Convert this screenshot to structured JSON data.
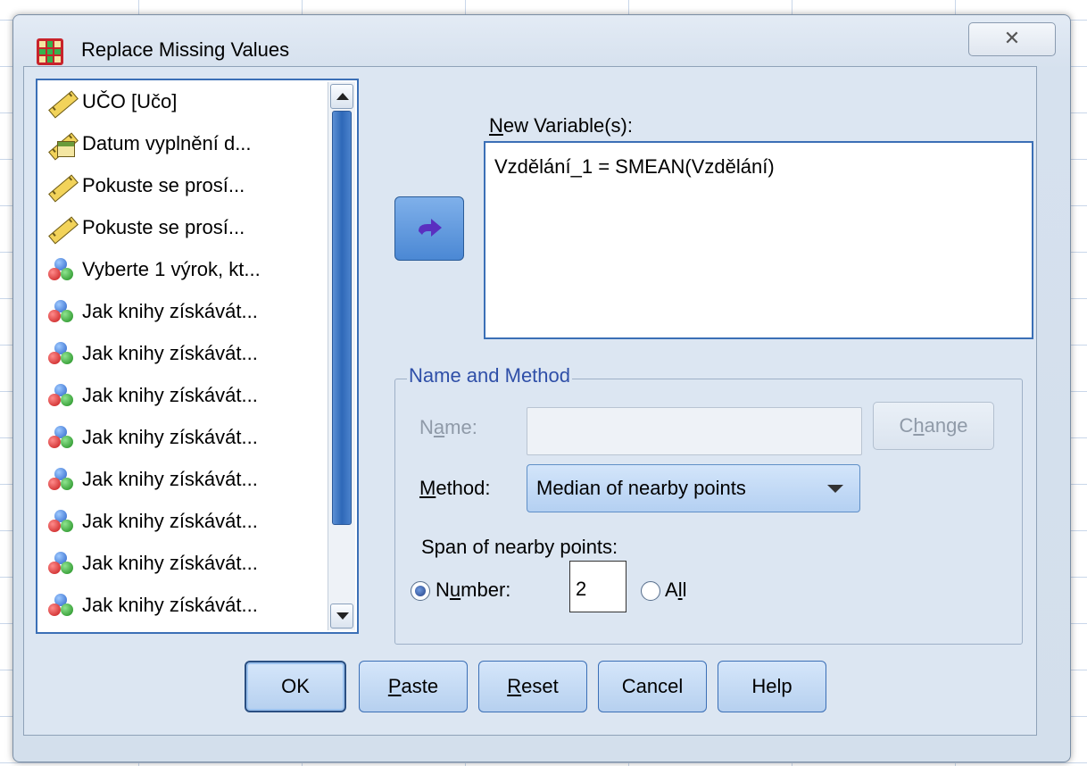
{
  "window": {
    "title": "Replace Missing Values",
    "close_glyph": "✕"
  },
  "variables": {
    "items": [
      {
        "label": "UČO [Učo]",
        "icon": "scale-ruler-icon"
      },
      {
        "label": "Datum vyplnění d...",
        "icon": "date-scale-icon"
      },
      {
        "label": "Pokuste se prosí...",
        "icon": "scale-ruler-icon"
      },
      {
        "label": "Pokuste se prosí...",
        "icon": "scale-ruler-icon"
      },
      {
        "label": "Vyberte 1 výrok, kt...",
        "icon": "nominal-balls-icon"
      },
      {
        "label": "Jak knihy získávát...",
        "icon": "nominal-balls-icon"
      },
      {
        "label": "Jak knihy získávát...",
        "icon": "nominal-balls-icon"
      },
      {
        "label": "Jak knihy získávát...",
        "icon": "nominal-balls-icon"
      },
      {
        "label": "Jak knihy získávát...",
        "icon": "nominal-balls-icon"
      },
      {
        "label": "Jak knihy získávát...",
        "icon": "nominal-balls-icon"
      },
      {
        "label": "Jak knihy získávát...",
        "icon": "nominal-balls-icon"
      },
      {
        "label": "Jak knihy získávát...",
        "icon": "nominal-balls-icon"
      },
      {
        "label": "Jak knihy získávát...",
        "icon": "nominal-balls-icon"
      }
    ]
  },
  "new_variables": {
    "label_hot": "N",
    "label_rest": "ew Variable(s):",
    "items": [
      "Vzdělání_1 = SMEAN(Vzdělání)"
    ]
  },
  "name_method": {
    "title": "Name and Method",
    "name_label_a": "N",
    "name_label_hot": "a",
    "name_label_b": "me:",
    "name_value": "",
    "change_a": "C",
    "change_hot": "h",
    "change_b": "ange",
    "method_label_hot": "M",
    "method_label_rest": "ethod:",
    "method_value": "Median of nearby points",
    "span_label": "Span of nearby points:",
    "number_a": "N",
    "number_hot": "u",
    "number_b": "mber:",
    "number_value": "2",
    "all_a": "A",
    "all_hot": "l",
    "all_b": "l"
  },
  "buttons": {
    "ok": "OK",
    "paste_hot": "P",
    "paste_rest": "aste",
    "reset_hot": "R",
    "reset_rest": "eset",
    "cancel": "Cancel",
    "help": "Help"
  }
}
